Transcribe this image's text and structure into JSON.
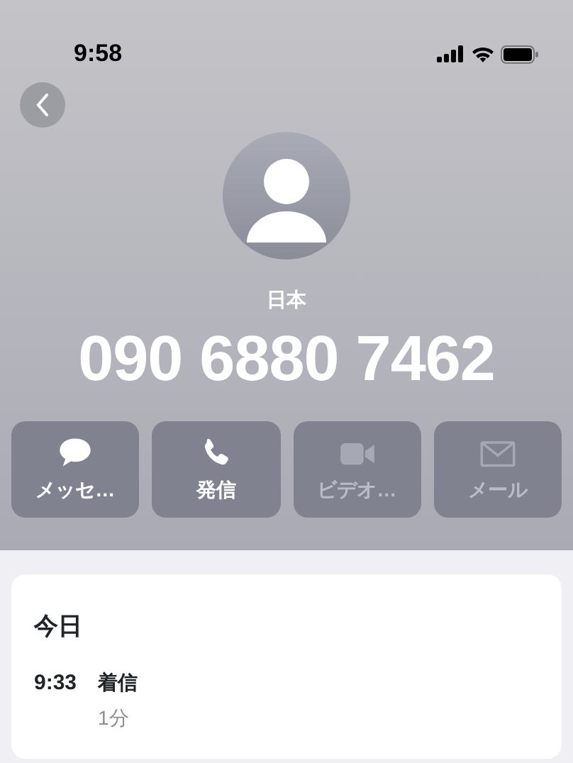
{
  "status_bar": {
    "time": "9:58"
  },
  "contact": {
    "label": "日本",
    "number": "090 6880 7462"
  },
  "actions": [
    {
      "kind": "message",
      "label": "メッセ…",
      "disabled": false
    },
    {
      "kind": "call",
      "label": "発信",
      "disabled": false
    },
    {
      "kind": "video",
      "label": "ビデオ…",
      "disabled": true
    },
    {
      "kind": "mail",
      "label": "メール",
      "disabled": true
    }
  ],
  "history": {
    "heading": "今日",
    "entries": [
      {
        "time": "9:33",
        "type": "着信",
        "duration": "1分"
      }
    ]
  }
}
